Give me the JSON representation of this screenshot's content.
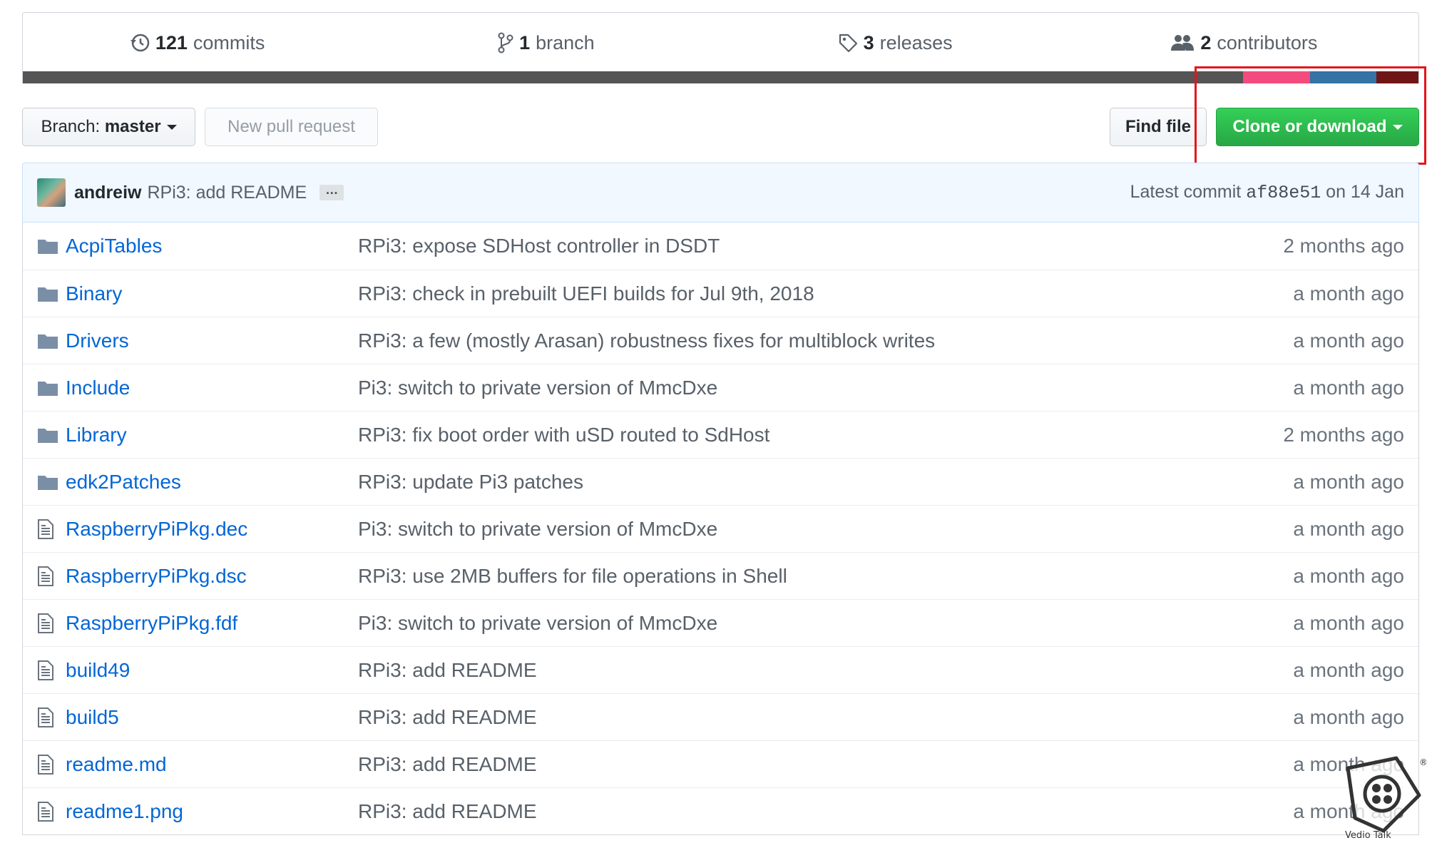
{
  "summary": {
    "commits": {
      "num": "121",
      "label": "commits",
      "icon": "history-icon"
    },
    "branches": {
      "num": "1",
      "label": "branch",
      "icon": "git-branch-icon"
    },
    "releases": {
      "num": "3",
      "label": "releases",
      "icon": "tag-icon"
    },
    "contributors": {
      "num": "2",
      "label": "contributors",
      "icon": "people-icon"
    }
  },
  "language_bar": {
    "colors": [
      "#555555",
      "#f34b7d",
      "#3572a5",
      "#701516"
    ]
  },
  "toolbar": {
    "branch_prefix": "Branch:",
    "branch_name": "master",
    "new_pull_request": "New pull request",
    "find_file": "Find file",
    "clone_or_download": "Clone or download"
  },
  "latest_commit": {
    "author": "andreiw",
    "message": "RPi3: add README",
    "ellipsis": "…",
    "prefix": "Latest commit",
    "sha": "af88e51",
    "date": "on 14 Jan"
  },
  "files": [
    {
      "type": "dir",
      "name": "AcpiTables",
      "message": "RPi3: expose SDHost controller in DSDT",
      "age": "2 months ago"
    },
    {
      "type": "dir",
      "name": "Binary",
      "message": "RPi3: check in prebuilt UEFI builds for Jul 9th, 2018",
      "age": "a month ago"
    },
    {
      "type": "dir",
      "name": "Drivers",
      "message": "RPi3: a few (mostly Arasan) robustness fixes for multiblock writes",
      "age": "a month ago"
    },
    {
      "type": "dir",
      "name": "Include",
      "message": "Pi3: switch to private version of MmcDxe",
      "age": "a month ago"
    },
    {
      "type": "dir",
      "name": "Library",
      "message": "RPi3: fix boot order with uSD routed to SdHost",
      "age": "2 months ago"
    },
    {
      "type": "dir",
      "name": "edk2Patches",
      "message": "RPi3: update Pi3 patches",
      "age": "a month ago"
    },
    {
      "type": "file",
      "name": "RaspberryPiPkg.dec",
      "message": "Pi3: switch to private version of MmcDxe",
      "age": "a month ago"
    },
    {
      "type": "file",
      "name": "RaspberryPiPkg.dsc",
      "message": "RPi3: use 2MB buffers for file operations in Shell",
      "age": "a month ago"
    },
    {
      "type": "file",
      "name": "RaspberryPiPkg.fdf",
      "message": "Pi3: switch to private version of MmcDxe",
      "age": "a month ago"
    },
    {
      "type": "file",
      "name": "build49",
      "message": "RPi3: add README",
      "age": "a month ago"
    },
    {
      "type": "file",
      "name": "build5",
      "message": "RPi3: add README",
      "age": "a month ago"
    },
    {
      "type": "file",
      "name": "readme.md",
      "message": "RPi3: add README",
      "age": "a month ago"
    },
    {
      "type": "file",
      "name": "readme1.png",
      "message": "RPi3: add README",
      "age": "a month ago"
    }
  ],
  "watermark": {
    "brand": "Vedio Talk",
    "reg": "®"
  },
  "colors": {
    "link": "#0366d6",
    "green": "#28a745",
    "highlight": "#e5151b"
  }
}
